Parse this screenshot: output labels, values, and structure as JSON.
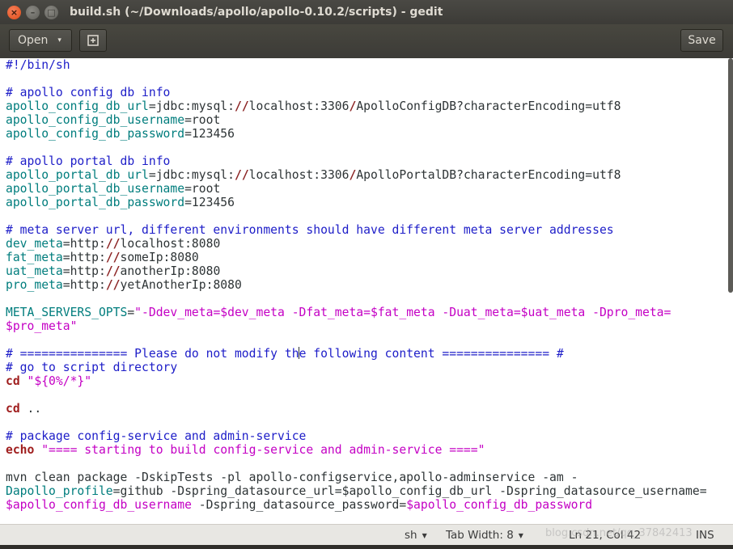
{
  "window": {
    "title": "build.sh (~/Downloads/apollo/apollo-0.10.2/scripts) - gedit",
    "close_glyph": "×",
    "min_glyph": "–",
    "max_glyph": "□"
  },
  "toolbar": {
    "open_label": "Open",
    "open_caret": "▾",
    "new_tab_glyph": "⊞",
    "save_label": "Save"
  },
  "statusbar": {
    "language": "sh",
    "tab_width": "Tab Width: 8",
    "position": "Ln 21, Col 42",
    "mode": "INS",
    "watermark": "blog.csdn.net/qq_37842413"
  },
  "editor": {
    "lines": [
      "#!/bin/sh",
      "",
      "# apollo config db info",
      "apollo_config_db_url=jdbc:mysql://localhost:3306/ApolloConfigDB?characterEncoding=utf8",
      "apollo_config_db_username=root",
      "apollo_config_db_password=123456",
      "",
      "# apollo portal db info",
      "apollo_portal_db_url=jdbc:mysql://localhost:3306/ApolloPortalDB?characterEncoding=utf8",
      "apollo_portal_db_username=root",
      "apollo_portal_db_password=123456",
      "",
      "# meta server url, different environments should have different meta server addresses",
      "dev_meta=http://localhost:8080",
      "fat_meta=http://someIp:8080",
      "uat_meta=http://anotherIp:8080",
      "pro_meta=http://yetAnotherIp:8080",
      "",
      "META_SERVERS_OPTS=\"-Ddev_meta=$dev_meta -Dfat_meta=$fat_meta -Duat_meta=$uat_meta -Dpro_meta=",
      "$pro_meta\"",
      "",
      "# =============== Please do not modify the following content =============== #",
      "# go to script directory",
      "cd \"${0%/*}\"",
      "",
      "cd ..",
      "",
      "# package config-service and admin-service",
      "echo \"==== starting to build config-service and admin-service ====\"",
      "",
      "mvn clean package -DskipTests -pl apollo-configservice,apollo-adminservice -am -",
      "Dapollo_profile=github -Dspring_datasource_url=$apollo_config_db_url -Dspring_datasource_username=",
      "$apollo_config_db_username -Dspring_datasource_password=$apollo_config_db_password"
    ]
  }
}
